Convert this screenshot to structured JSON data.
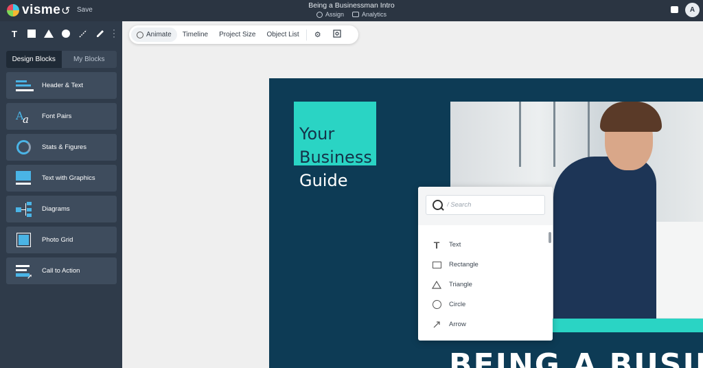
{
  "topbar": {
    "brand": "visme",
    "save_label": "Save",
    "doc_title": "Being a Businessman Intro",
    "assign_label": "Assign",
    "analytics_label": "Analytics",
    "avatar_initial": "A"
  },
  "sidebar": {
    "tool_text": "T",
    "tabs": [
      {
        "label": "Design Blocks",
        "active": true
      },
      {
        "label": "My Blocks",
        "active": false
      }
    ],
    "blocks": [
      {
        "label": "Header & Text",
        "icon": "header-text-icon"
      },
      {
        "label": "Font Pairs",
        "icon": "font-pairs-icon"
      },
      {
        "label": "Stats & Figures",
        "icon": "stats-icon"
      },
      {
        "label": "Text with Graphics",
        "icon": "text-graphics-icon"
      },
      {
        "label": "Diagrams",
        "icon": "diagram-icon"
      },
      {
        "label": "Photo Grid",
        "icon": "photo-grid-icon"
      },
      {
        "label": "Call to Action",
        "icon": "call-to-action-icon"
      }
    ]
  },
  "toolbar": {
    "animate": "Animate",
    "timeline": "Timeline",
    "project_size": "Project Size",
    "object_list": "Object List"
  },
  "canvas": {
    "headline_line1": "Your",
    "headline_line2": "Business",
    "headline_line3": "Guide",
    "big_title": "BEING A BUSIN",
    "accent_color": "#2ad4c4",
    "background_color": "#0d3b55"
  },
  "picker": {
    "search_placeholder": "/ Search",
    "items": [
      {
        "label": "Text",
        "icon": "text-icon"
      },
      {
        "label": "Rectangle",
        "icon": "rectangle-icon"
      },
      {
        "label": "Triangle",
        "icon": "triangle-icon"
      },
      {
        "label": "Circle",
        "icon": "circle-icon"
      },
      {
        "label": "Arrow",
        "icon": "arrow-icon"
      }
    ]
  }
}
